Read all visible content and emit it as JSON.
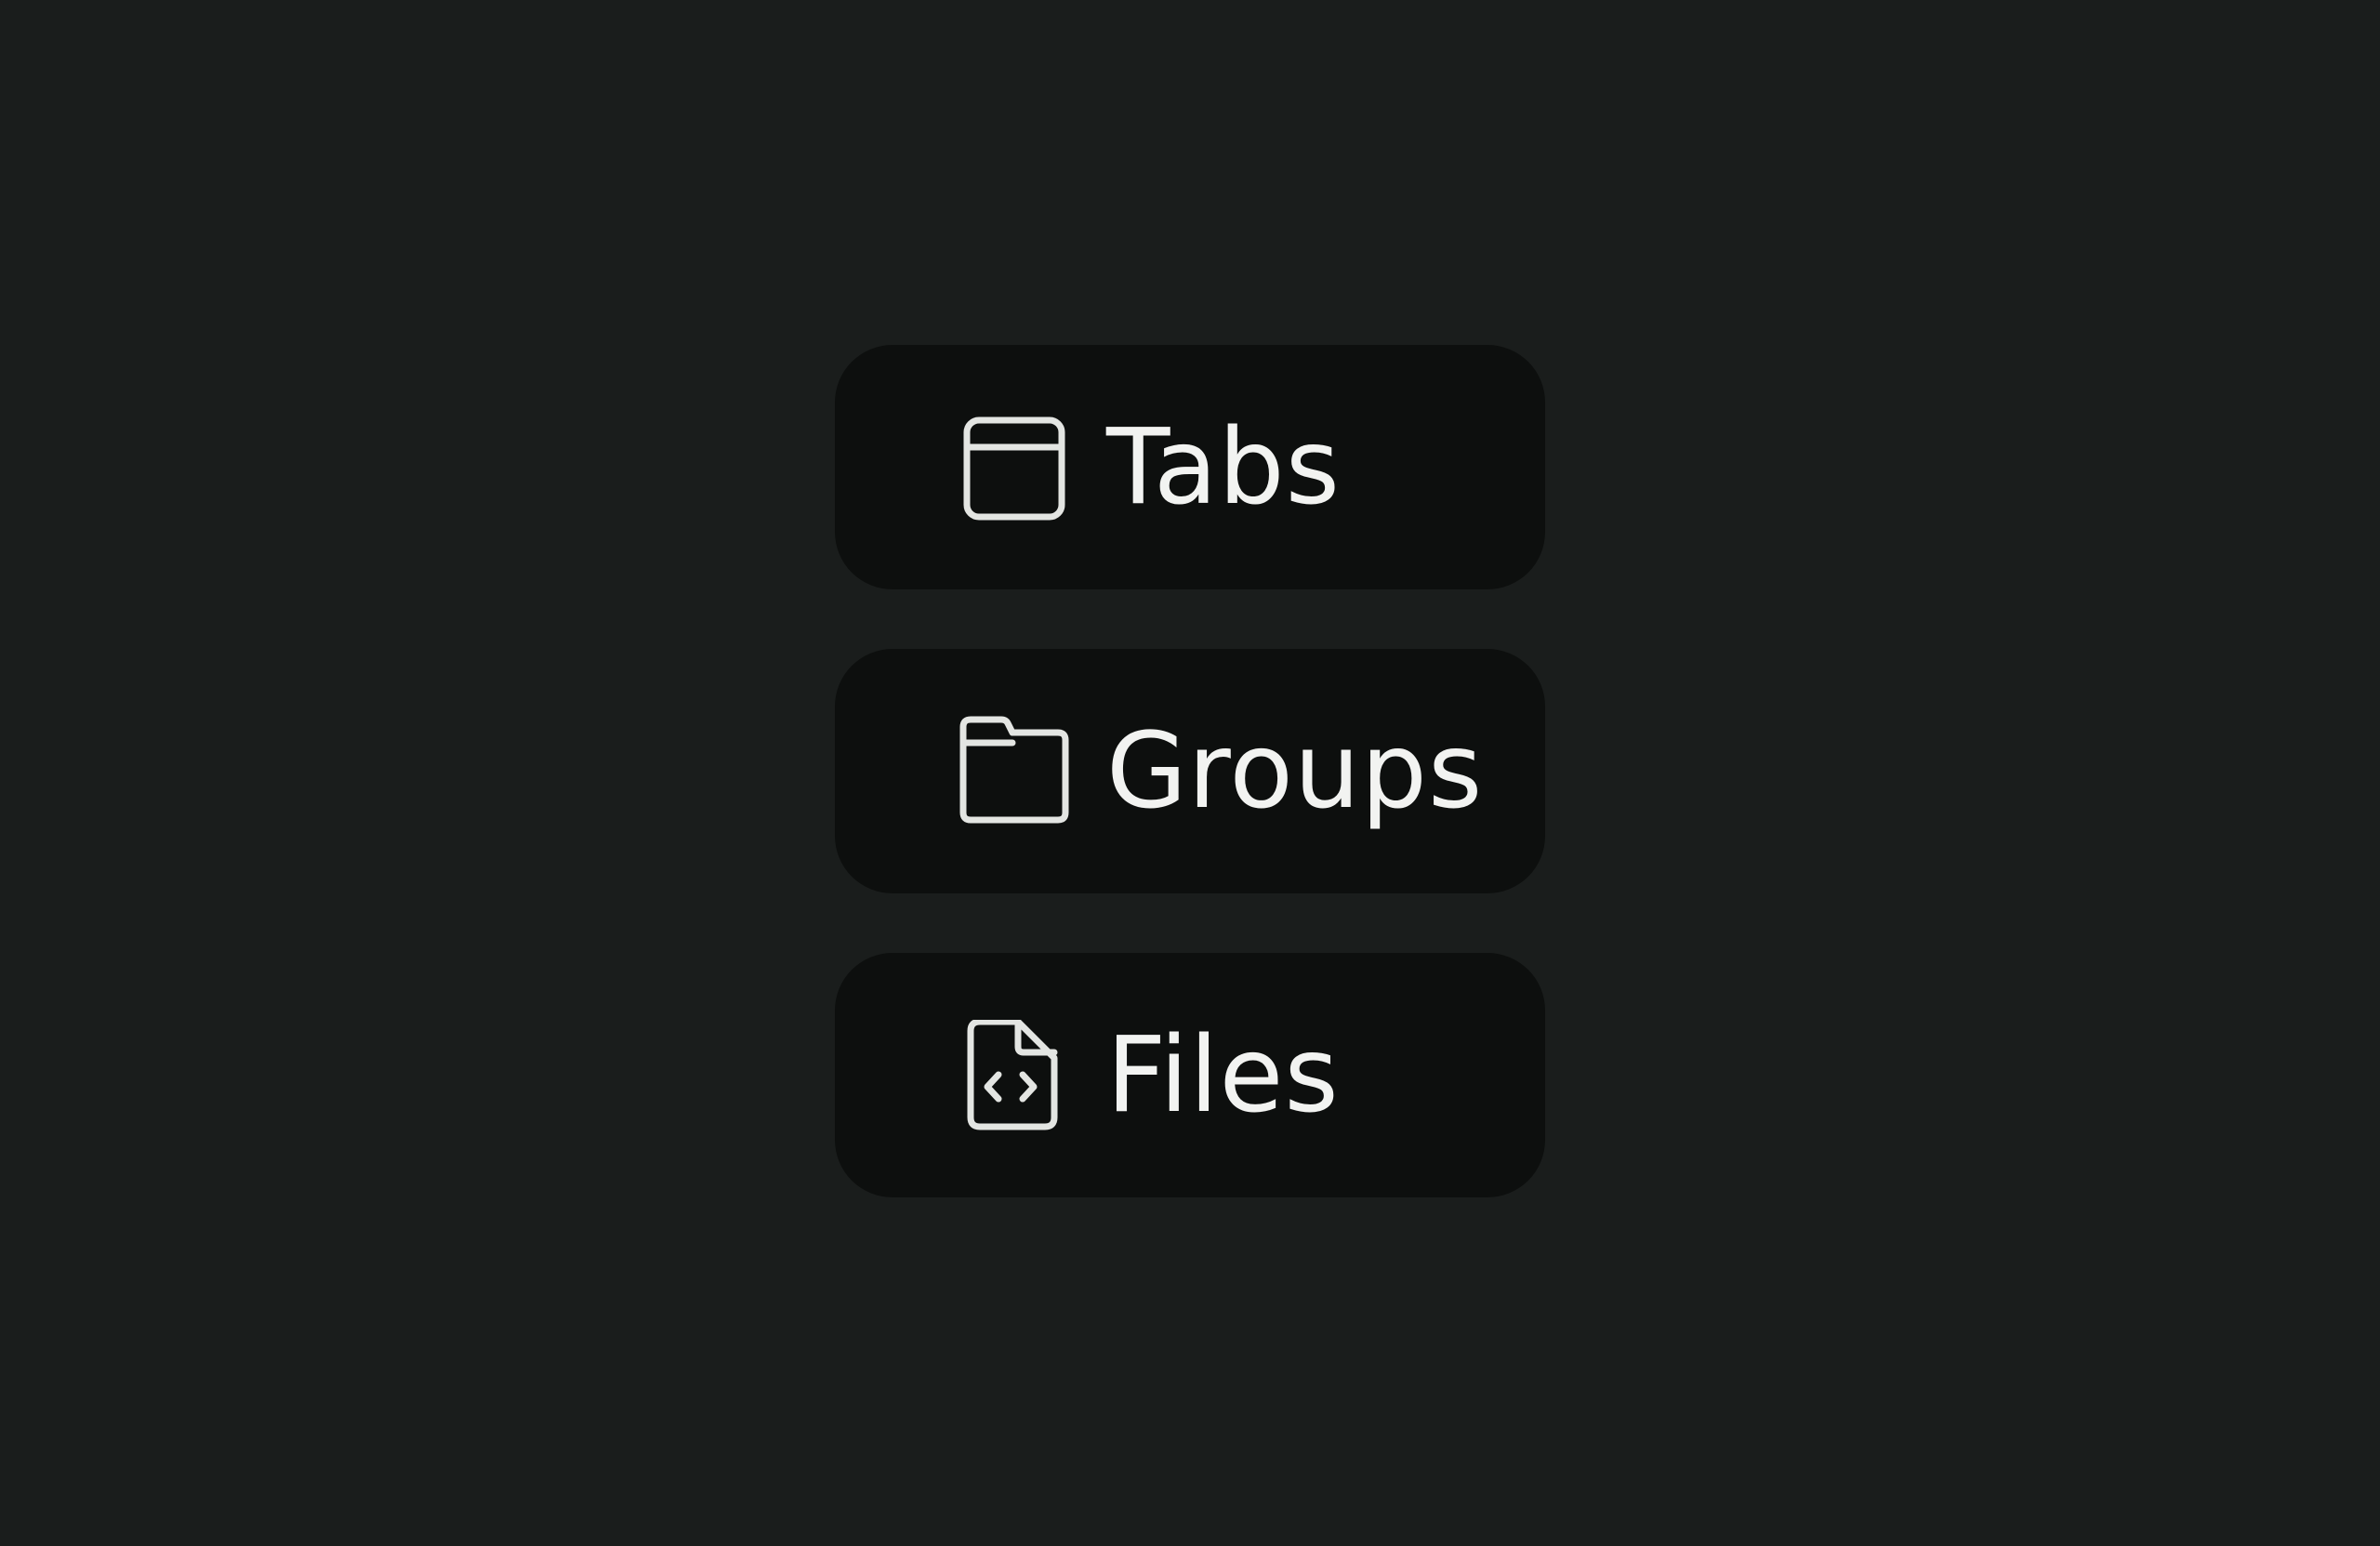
{
  "menu": {
    "items": [
      {
        "icon": "browser-window-icon",
        "label": "Tabs"
      },
      {
        "icon": "folder-icon",
        "label": "Groups"
      },
      {
        "icon": "code-file-icon",
        "label": "Files"
      }
    ]
  },
  "colors": {
    "background": "#1a1d1c",
    "item_background": "#0d0f0e",
    "icon_stroke": "#e3e5e2",
    "text": "#f2f3f1"
  }
}
